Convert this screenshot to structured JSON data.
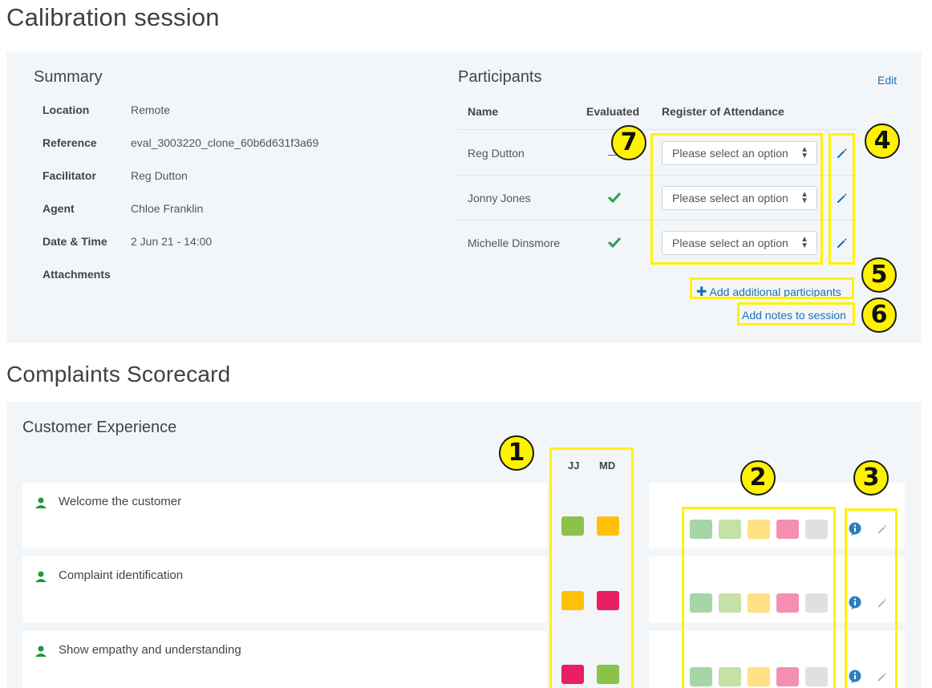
{
  "page_title": "Calibration session",
  "summary": {
    "title": "Summary",
    "fields": [
      {
        "label": "Location",
        "value": "Remote"
      },
      {
        "label": "Reference",
        "value": "eval_3003220_clone_60b6d631f3a69"
      },
      {
        "label": "Facilitator",
        "value": "Reg Dutton"
      },
      {
        "label": "Agent",
        "value": "Chloe Franklin"
      },
      {
        "label": "Date & Time",
        "value": "2 Jun 21 - 14:00"
      },
      {
        "label": "Attachments",
        "value": ""
      }
    ]
  },
  "participants": {
    "title": "Participants",
    "edit_label": "Edit",
    "columns": {
      "name": "Name",
      "evaluated": "Evaluated",
      "attendance": "Register of Attendance"
    },
    "rows": [
      {
        "name": "Reg Dutton",
        "evaluated": "—",
        "attendance": "Please select an option"
      },
      {
        "name": "Jonny Jones",
        "evaluated": "check",
        "attendance": "Please select an option"
      },
      {
        "name": "Michelle Dinsmore",
        "evaluated": "check",
        "attendance": "Please select an option"
      }
    ],
    "add_participants_label": "Add additional participants",
    "add_notes_label": "Add notes to session"
  },
  "scorecard": {
    "title": "Complaints Scorecard",
    "section_title": "Customer Experience",
    "evaluator_columns": [
      "JJ",
      "MD"
    ],
    "criteria": [
      {
        "label": "Welcome the customer",
        "scores": [
          "#8bc34a",
          "#ffc107"
        ]
      },
      {
        "label": "Complaint identification",
        "scores": [
          "#ffc107",
          "#e91e63"
        ]
      },
      {
        "label": "Show empathy and understanding",
        "scores": [
          "#e91e63",
          "#8bc34a"
        ]
      }
    ],
    "rating_options": [
      "#a5d6a7",
      "#c5e1a5",
      "#ffe082",
      "#f48fb1",
      "#e0e0e0"
    ]
  },
  "annotations": [
    "1",
    "2",
    "3",
    "4",
    "5",
    "6",
    "7"
  ],
  "colors": {
    "panel_bg": "#f3f6f9",
    "link": "#1f6fb2",
    "check": "#2e9e4f",
    "highlight": "#fff200"
  }
}
